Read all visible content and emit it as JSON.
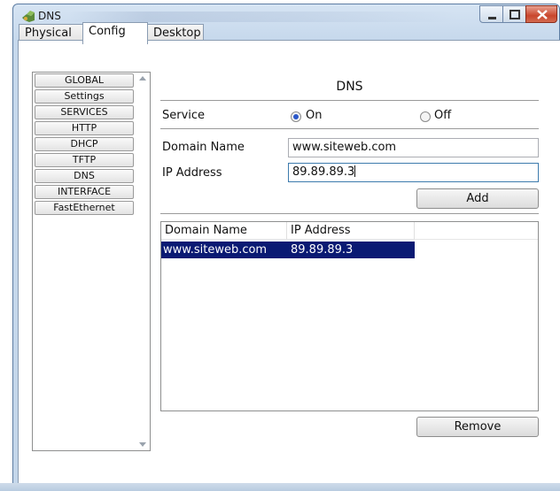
{
  "window": {
    "title": "DNS"
  },
  "tabs": [
    {
      "label": "Physical"
    },
    {
      "label": "Config"
    },
    {
      "label": "Desktop"
    }
  ],
  "sidebar": {
    "items": [
      {
        "label": "GLOBAL"
      },
      {
        "label": "Settings"
      },
      {
        "label": "SERVICES"
      },
      {
        "label": "HTTP"
      },
      {
        "label": "DHCP"
      },
      {
        "label": "TFTP"
      },
      {
        "label": "DNS"
      },
      {
        "label": "INTERFACE"
      },
      {
        "label": "FastEthernet"
      }
    ]
  },
  "dns": {
    "header": "DNS",
    "service_label": "Service",
    "on_label": "On",
    "off_label": "Off",
    "service_state": "On",
    "domain_label": "Domain Name",
    "domain_value": "www.siteweb.com",
    "ip_label": "IP Address",
    "ip_value": "89.89.89.3",
    "add_label": "Add",
    "remove_label": "Remove"
  },
  "table": {
    "columns": [
      "Domain Name",
      "IP Address"
    ],
    "rows": [
      {
        "domain": "www.siteweb.com",
        "ip": "89.89.89.3",
        "selected": true
      }
    ]
  },
  "colors": {
    "selection": "#0a1a73",
    "radio_accent": "#2a57c9"
  }
}
